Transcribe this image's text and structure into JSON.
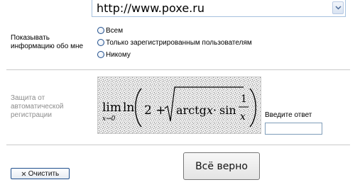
{
  "url_field": {
    "value": "http://www.poxe.ru",
    "dropdown_icon": "chevron-down-icon"
  },
  "privacy": {
    "label_line1": "Показывать",
    "label_line2": "информацию обо мне",
    "options": [
      {
        "label": "Всем",
        "selected": false
      },
      {
        "label": "Только зарегистрированным пользователям",
        "selected": false
      },
      {
        "label": "Никому",
        "selected": false
      }
    ]
  },
  "captcha": {
    "label_line1": "Защита от",
    "label_line2": "автоматической",
    "label_line3": "регистрации",
    "answer_label": "Введите ответ",
    "answer_value": ""
  },
  "buttons": {
    "submit_label": "Всё верно",
    "reset_label": "Очистить",
    "reset_icon": "close-icon"
  },
  "colors": {
    "divider": "#c9c9c9",
    "muted_label": "#8c8c8c",
    "radio_border": "#1f4e8c"
  }
}
